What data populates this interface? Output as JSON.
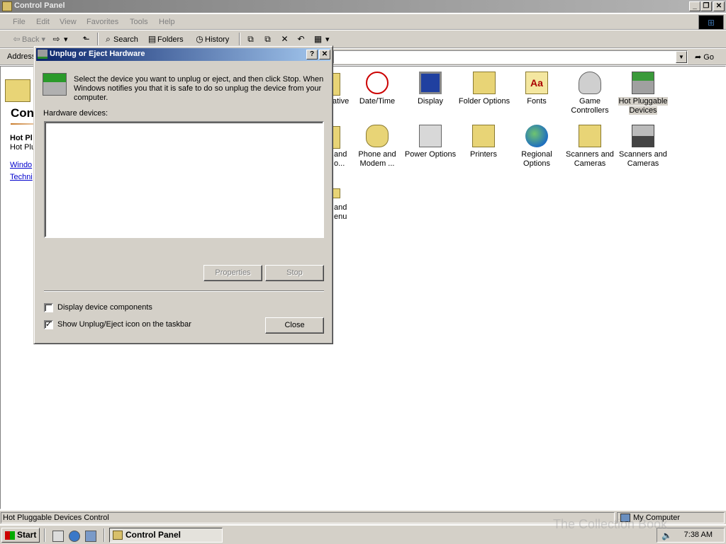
{
  "window": {
    "title": "Control Panel",
    "controls": {
      "minimize": "_",
      "restore": "❐",
      "close": "✕"
    }
  },
  "menu": [
    "File",
    "Edit",
    "View",
    "Favorites",
    "Tools",
    "Help"
  ],
  "toolbar": {
    "back": "Back",
    "search": "Search",
    "folders": "Folders",
    "history": "History"
  },
  "address": {
    "label": "Address",
    "go": "Go"
  },
  "left_pane": {
    "title": "Con",
    "heading": "Hot Pl",
    "desc": "Hot Plu",
    "link1": "Windo",
    "link2": "Techni"
  },
  "items": [
    {
      "label": "Date/Time",
      "icon": "clock-icon"
    },
    {
      "label": "Display",
      "icon": "display-icon"
    },
    {
      "label": "Folder Options",
      "icon": "folder-options-icon"
    },
    {
      "label": "Fonts",
      "icon": "fonts-icon"
    },
    {
      "label": "Game Controllers",
      "icon": "joystick-icon"
    },
    {
      "label": "Hot Pluggable Devices",
      "icon": "hot-plug-icon"
    },
    {
      "label": "Phone and Modem ...",
      "icon": "phone-icon"
    },
    {
      "label": "Power Options",
      "icon": "power-icon"
    },
    {
      "label": "Printers",
      "icon": "printer-icon"
    },
    {
      "label": "Regional Options",
      "icon": "globe-icon"
    },
    {
      "label": "Scanners and Cameras",
      "icon": "scanner-icon"
    },
    {
      "label": "Scanners and Cameras",
      "icon": "scanner-icon"
    }
  ],
  "partial_labels": [
    "ative",
    "and",
    "o...",
    "and",
    "enu"
  ],
  "dialog": {
    "title": "Unplug or Eject Hardware",
    "instructions": "Select the device you want to unplug or eject, and then click Stop. When Windows notifies you that it is safe to do so unplug the device from your computer.",
    "hw_label": "Hardware devices:",
    "properties": "Properties",
    "stop": "Stop",
    "close": "Close",
    "chk_components": "Display device components",
    "chk_components_checked": false,
    "chk_show_icon": "Show Unplug/Eject icon on the taskbar",
    "chk_show_icon_checked": true
  },
  "status": {
    "left": "Hot Pluggable Devices Control",
    "right": "My Computer"
  },
  "taskbar": {
    "start": "Start",
    "task": "Control Panel",
    "clock": "7:38 AM"
  },
  "watermark": "The Collection Book"
}
